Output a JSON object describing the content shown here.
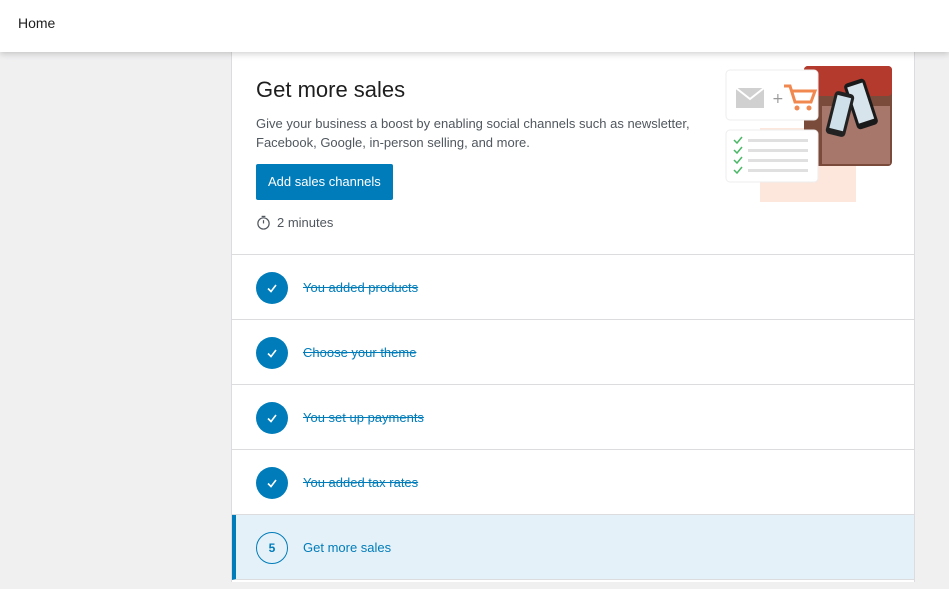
{
  "header": {
    "title": "Home"
  },
  "hero": {
    "title": "Get more sales",
    "description": "Give your business a boost by enabling social channels such as newsletter, Facebook, Google, in-person selling, and more.",
    "cta_label": "Add sales channels",
    "time_estimate": "2 minutes"
  },
  "tasks": [
    {
      "label": "You added products",
      "completed": true
    },
    {
      "label": "Choose your theme",
      "completed": true
    },
    {
      "label": "You set up payments",
      "completed": true
    },
    {
      "label": "You added tax rates",
      "completed": true
    },
    {
      "label": "Get more sales",
      "completed": false,
      "number": "5",
      "active": true
    }
  ],
  "colors": {
    "accent": "#007cba",
    "active_bg": "#e5f1f8",
    "cart_orange": "#f0884f",
    "check_green": "#4ab866"
  }
}
